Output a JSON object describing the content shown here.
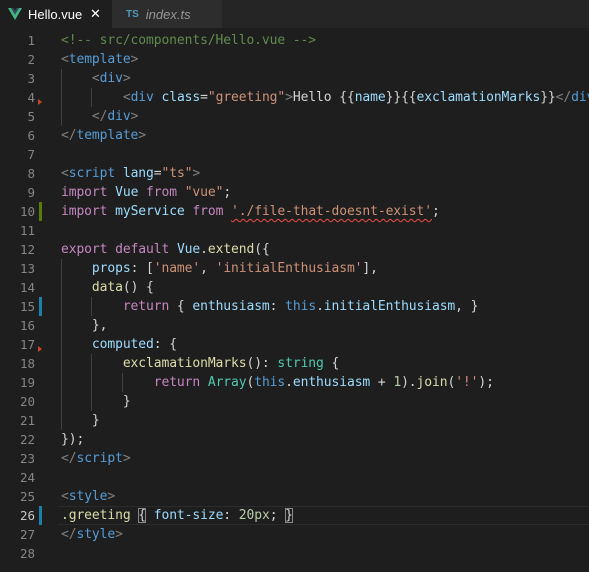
{
  "tabs": [
    {
      "title": "Hello.vue",
      "icon": "vue-logo-icon",
      "active": true,
      "close": "✕"
    },
    {
      "title": "index.ts",
      "icon": "ts-file-icon",
      "badge": "TS",
      "active": false
    }
  ],
  "colors": {
    "background": "#1e1e1e",
    "tabbar": "#252526",
    "comment": "#608b4e",
    "tag": "#569cd6",
    "string": "#ce9178",
    "keyword": "#c586c0",
    "function": "#dcdcaa",
    "property": "#9cdcfe",
    "type": "#4ec9b0",
    "number": "#b5cea8",
    "error": "#f14c4c",
    "gutter_modified": "#1b81a8",
    "gutter_added": "#587c0c"
  },
  "editor": {
    "active_line": 26,
    "lines": [
      {
        "n": "1",
        "segs": [
          {
            "t": "<!-- src/components/Hello.vue -->",
            "c": "k-comment"
          }
        ]
      },
      {
        "n": "2",
        "segs": [
          {
            "t": "<",
            "c": "k-bracket"
          },
          {
            "t": "template",
            "c": "k-tag"
          },
          {
            "t": ">",
            "c": "k-bracket"
          }
        ]
      },
      {
        "n": "3",
        "segs": [
          {
            "t": "    ",
            "c": "k-plain"
          },
          {
            "t": "<",
            "c": "k-bracket"
          },
          {
            "t": "div",
            "c": "k-tag"
          },
          {
            "t": ">",
            "c": "k-bracket"
          }
        ]
      },
      {
        "n": "4",
        "segs": [
          {
            "t": "        ",
            "c": "k-plain"
          },
          {
            "t": "<",
            "c": "k-bracket"
          },
          {
            "t": "div",
            "c": "k-tag"
          },
          {
            "t": " ",
            "c": "k-plain"
          },
          {
            "t": "class",
            "c": "k-attr"
          },
          {
            "t": "=",
            "c": "k-plain"
          },
          {
            "t": "\"greeting\"",
            "c": "k-string"
          },
          {
            "t": ">",
            "c": "k-bracket"
          },
          {
            "t": "Hello {{",
            "c": "k-plain"
          },
          {
            "t": "name",
            "c": "k-prop"
          },
          {
            "t": "}}{{",
            "c": "k-plain"
          },
          {
            "t": "exclamationMarks",
            "c": "k-prop"
          },
          {
            "t": "}}",
            "c": "k-plain"
          },
          {
            "t": "</",
            "c": "k-bracket"
          },
          {
            "t": "div",
            "c": "k-tag"
          },
          {
            "t": ">",
            "c": "k-bracket"
          }
        ]
      },
      {
        "n": "5",
        "segs": [
          {
            "t": "    ",
            "c": "k-plain"
          },
          {
            "t": "</",
            "c": "k-bracket"
          },
          {
            "t": "div",
            "c": "k-tag"
          },
          {
            "t": ">",
            "c": "k-bracket"
          }
        ]
      },
      {
        "n": "6",
        "segs": [
          {
            "t": "</",
            "c": "k-bracket"
          },
          {
            "t": "template",
            "c": "k-tag"
          },
          {
            "t": ">",
            "c": "k-bracket"
          }
        ]
      },
      {
        "n": "7",
        "segs": []
      },
      {
        "n": "8",
        "segs": [
          {
            "t": "<",
            "c": "k-bracket"
          },
          {
            "t": "script",
            "c": "k-tag"
          },
          {
            "t": " ",
            "c": "k-plain"
          },
          {
            "t": "lang",
            "c": "k-attr"
          },
          {
            "t": "=",
            "c": "k-plain"
          },
          {
            "t": "\"ts\"",
            "c": "k-string"
          },
          {
            "t": ">",
            "c": "k-bracket"
          }
        ]
      },
      {
        "n": "9",
        "segs": [
          {
            "t": "import",
            "c": "k-keyword"
          },
          {
            "t": " ",
            "c": "k-plain"
          },
          {
            "t": "Vue",
            "c": "k-prop"
          },
          {
            "t": " ",
            "c": "k-plain"
          },
          {
            "t": "from",
            "c": "k-keyword"
          },
          {
            "t": " ",
            "c": "k-plain"
          },
          {
            "t": "\"vue\"",
            "c": "k-string"
          },
          {
            "t": ";",
            "c": "k-plain"
          }
        ]
      },
      {
        "n": "10",
        "segs": [
          {
            "t": "import",
            "c": "k-keyword"
          },
          {
            "t": " ",
            "c": "k-plain"
          },
          {
            "t": "myService",
            "c": "k-prop"
          },
          {
            "t": " ",
            "c": "k-plain"
          },
          {
            "t": "from",
            "c": "k-keyword"
          },
          {
            "t": " ",
            "c": "k-plain"
          },
          {
            "t": "'./file-that-doesnt-exist'",
            "c": "k-string squiggle"
          },
          {
            "t": ";",
            "c": "k-plain"
          }
        ]
      },
      {
        "n": "11",
        "segs": []
      },
      {
        "n": "12",
        "segs": [
          {
            "t": "export",
            "c": "k-keyword"
          },
          {
            "t": " ",
            "c": "k-plain"
          },
          {
            "t": "default",
            "c": "k-keyword"
          },
          {
            "t": " ",
            "c": "k-plain"
          },
          {
            "t": "Vue",
            "c": "k-prop"
          },
          {
            "t": ".",
            "c": "k-plain"
          },
          {
            "t": "extend",
            "c": "k-fn"
          },
          {
            "t": "({",
            "c": "k-plain"
          }
        ]
      },
      {
        "n": "13",
        "segs": [
          {
            "t": "    ",
            "c": "k-plain"
          },
          {
            "t": "props",
            "c": "k-prop"
          },
          {
            "t": ": [",
            "c": "k-plain"
          },
          {
            "t": "'name'",
            "c": "k-string"
          },
          {
            "t": ", ",
            "c": "k-plain"
          },
          {
            "t": "'initialEnthusiasm'",
            "c": "k-string"
          },
          {
            "t": "],",
            "c": "k-plain"
          }
        ]
      },
      {
        "n": "14",
        "segs": [
          {
            "t": "    ",
            "c": "k-plain"
          },
          {
            "t": "data",
            "c": "k-fn"
          },
          {
            "t": "() {",
            "c": "k-plain"
          }
        ]
      },
      {
        "n": "15",
        "segs": [
          {
            "t": "        ",
            "c": "k-plain"
          },
          {
            "t": "return",
            "c": "k-keyword"
          },
          {
            "t": " { ",
            "c": "k-plain"
          },
          {
            "t": "enthusiasm",
            "c": "k-prop"
          },
          {
            "t": ": ",
            "c": "k-plain"
          },
          {
            "t": "this",
            "c": "k-blue"
          },
          {
            "t": ".",
            "c": "k-plain"
          },
          {
            "t": "initialEnthusiasm",
            "c": "k-prop"
          },
          {
            "t": ", }",
            "c": "k-plain"
          }
        ]
      },
      {
        "n": "16",
        "segs": [
          {
            "t": "    },",
            "c": "k-plain"
          }
        ]
      },
      {
        "n": "17",
        "segs": [
          {
            "t": "    ",
            "c": "k-plain"
          },
          {
            "t": "computed",
            "c": "k-prop"
          },
          {
            "t": ": {",
            "c": "k-plain"
          }
        ]
      },
      {
        "n": "18",
        "segs": [
          {
            "t": "        ",
            "c": "k-plain"
          },
          {
            "t": "exclamationMarks",
            "c": "k-fn"
          },
          {
            "t": "(): ",
            "c": "k-plain"
          },
          {
            "t": "string",
            "c": "k-type"
          },
          {
            "t": " {",
            "c": "k-plain"
          }
        ]
      },
      {
        "n": "19",
        "segs": [
          {
            "t": "            ",
            "c": "k-plain"
          },
          {
            "t": "return",
            "c": "k-keyword"
          },
          {
            "t": " ",
            "c": "k-plain"
          },
          {
            "t": "Array",
            "c": "k-type"
          },
          {
            "t": "(",
            "c": "k-plain"
          },
          {
            "t": "this",
            "c": "k-blue"
          },
          {
            "t": ".",
            "c": "k-plain"
          },
          {
            "t": "enthusiasm",
            "c": "k-prop"
          },
          {
            "t": " + ",
            "c": "k-plain"
          },
          {
            "t": "1",
            "c": "k-num"
          },
          {
            "t": ").",
            "c": "k-plain"
          },
          {
            "t": "join",
            "c": "k-fn"
          },
          {
            "t": "(",
            "c": "k-plain"
          },
          {
            "t": "'!'",
            "c": "k-string"
          },
          {
            "t": ");",
            "c": "k-plain"
          }
        ]
      },
      {
        "n": "20",
        "segs": [
          {
            "t": "        }",
            "c": "k-plain"
          }
        ]
      },
      {
        "n": "21",
        "segs": [
          {
            "t": "    }",
            "c": "k-plain"
          }
        ]
      },
      {
        "n": "22",
        "segs": [
          {
            "t": "});",
            "c": "k-plain"
          }
        ]
      },
      {
        "n": "23",
        "segs": [
          {
            "t": "</",
            "c": "k-bracket"
          },
          {
            "t": "script",
            "c": "k-tag"
          },
          {
            "t": ">",
            "c": "k-bracket"
          }
        ]
      },
      {
        "n": "24",
        "segs": []
      },
      {
        "n": "25",
        "segs": [
          {
            "t": "<",
            "c": "k-bracket"
          },
          {
            "t": "style",
            "c": "k-tag"
          },
          {
            "t": ">",
            "c": "k-bracket"
          }
        ]
      },
      {
        "n": "26",
        "segs": [
          {
            "t": ".greeting",
            "c": "k-fn"
          },
          {
            "t": " ",
            "c": "k-plain"
          },
          {
            "t": "{",
            "c": "k-plain bracket-match"
          },
          {
            "t": " ",
            "c": "k-plain"
          },
          {
            "t": "font-size",
            "c": "k-prop"
          },
          {
            "t": ": ",
            "c": "k-plain"
          },
          {
            "t": "20px",
            "c": "k-num"
          },
          {
            "t": "; ",
            "c": "k-plain"
          },
          {
            "t": "}",
            "c": "k-plain bracket-match"
          }
        ]
      },
      {
        "n": "27",
        "segs": [
          {
            "t": "</",
            "c": "k-bracket"
          },
          {
            "t": "style",
            "c": "k-tag"
          },
          {
            "t": ">",
            "c": "k-bracket"
          }
        ]
      },
      {
        "n": "28",
        "segs": []
      }
    ]
  }
}
